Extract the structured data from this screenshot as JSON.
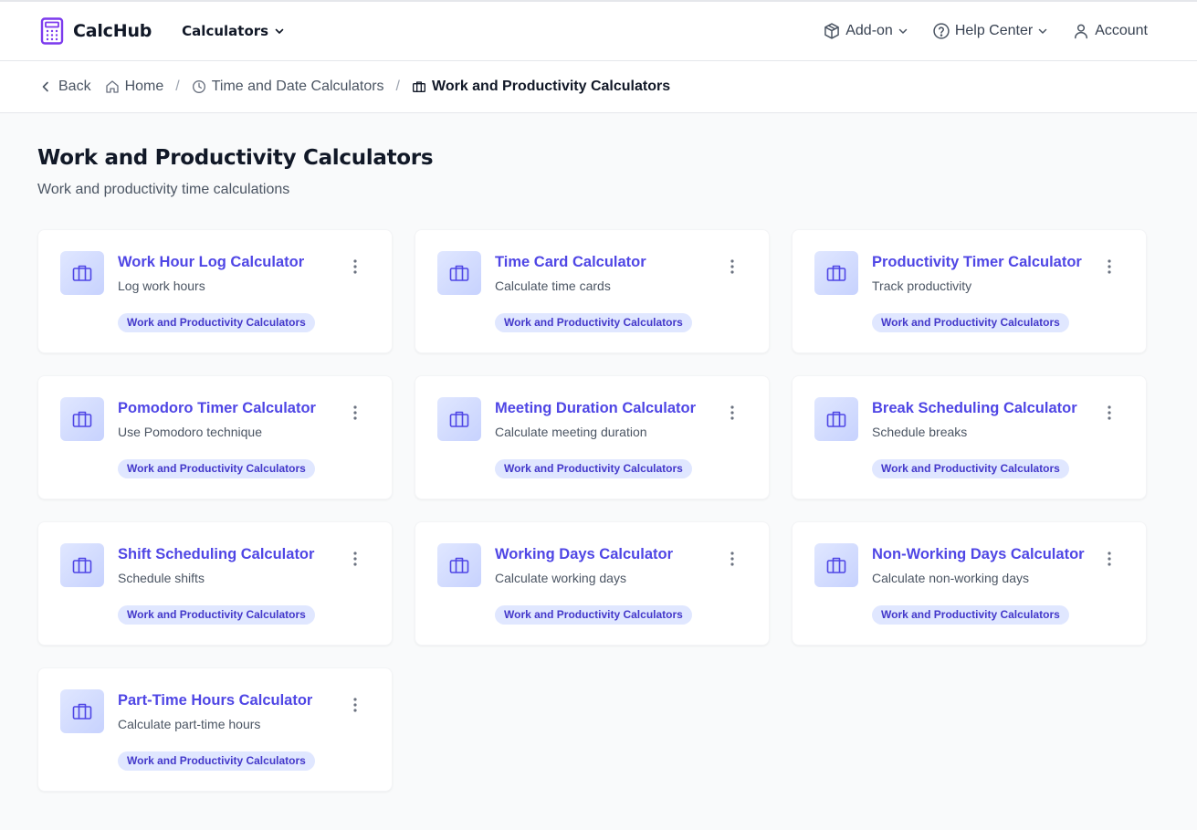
{
  "brand": {
    "name": "CalcHub",
    "icon": "calculator-icon",
    "accent": "#7c3aed"
  },
  "nav": {
    "calculators_label": "Calculators",
    "addon_label": "Add-on",
    "help_label": "Help Center",
    "account_label": "Account"
  },
  "breadcrumb": {
    "back_label": "Back",
    "home_label": "Home",
    "section_label": "Time and Date Calculators",
    "current_label": "Work and Productivity Calculators"
  },
  "page": {
    "title": "Work and Productivity Calculators",
    "subtitle": "Work and productivity time calculations"
  },
  "cards": [
    {
      "title": "Work Hour Log Calculator",
      "description": "Log work hours",
      "tag": "Work and Productivity Calculators",
      "icon": "briefcase-icon"
    },
    {
      "title": "Time Card Calculator",
      "description": "Calculate time cards",
      "tag": "Work and Productivity Calculators",
      "icon": "briefcase-icon"
    },
    {
      "title": "Productivity Timer Calculator",
      "description": "Track productivity",
      "tag": "Work and Productivity Calculators",
      "icon": "briefcase-icon"
    },
    {
      "title": "Pomodoro Timer Calculator",
      "description": "Use Pomodoro technique",
      "tag": "Work and Productivity Calculators",
      "icon": "briefcase-icon"
    },
    {
      "title": "Meeting Duration Calculator",
      "description": "Calculate meeting duration",
      "tag": "Work and Productivity Calculators",
      "icon": "briefcase-icon"
    },
    {
      "title": "Break Scheduling Calculator",
      "description": "Schedule breaks",
      "tag": "Work and Productivity Calculators",
      "icon": "briefcase-icon"
    },
    {
      "title": "Shift Scheduling Calculator",
      "description": "Schedule shifts",
      "tag": "Work and Productivity Calculators",
      "icon": "briefcase-icon"
    },
    {
      "title": "Working Days Calculator",
      "description": "Calculate working days",
      "tag": "Work and Productivity Calculators",
      "icon": "briefcase-icon"
    },
    {
      "title": "Non-Working Days Calculator",
      "description": "Calculate non-working days",
      "tag": "Work and Productivity Calculators",
      "icon": "briefcase-icon"
    },
    {
      "title": "Part-Time Hours Calculator",
      "description": "Calculate part-time hours",
      "tag": "Work and Productivity Calculators",
      "icon": "briefcase-icon"
    }
  ],
  "colors": {
    "title_accent": "#4f46e5",
    "tag_bg": "#e0e7ff",
    "tag_text": "#4338ca",
    "page_bg": "#f9fafb"
  }
}
